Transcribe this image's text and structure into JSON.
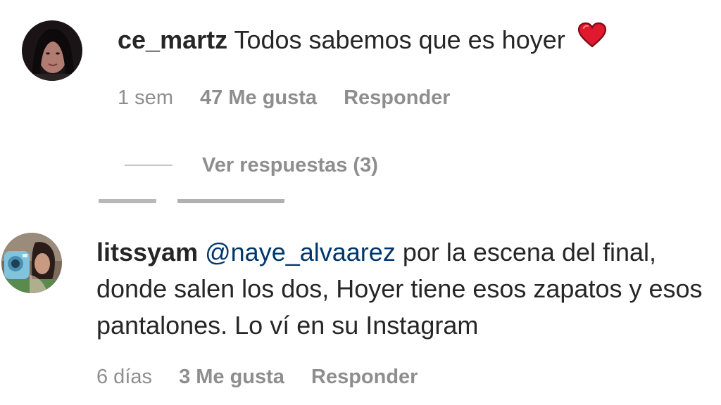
{
  "comments": [
    {
      "username": "ce_martz",
      "text": "Todos sabemos que es hoyer",
      "emoji": "heart-icon",
      "time": "1 sem",
      "likes": "47 Me gusta",
      "reply_label": "Responder",
      "view_replies": "Ver respuestas (3)"
    },
    {
      "username": "litssyam",
      "mention": "@naye_alvaarez",
      "text": " por la escena del final, donde salen los dos, Hoyer tiene esos zapatos y esos pantalones. Lo ví en su Instagram",
      "time": "6 días",
      "likes": "3 Me gusta",
      "reply_label": "Responder"
    }
  ],
  "colors": {
    "text": "#262626",
    "secondary": "#8e8e8e",
    "mention": "#00376b",
    "heart": "#e0192e"
  }
}
